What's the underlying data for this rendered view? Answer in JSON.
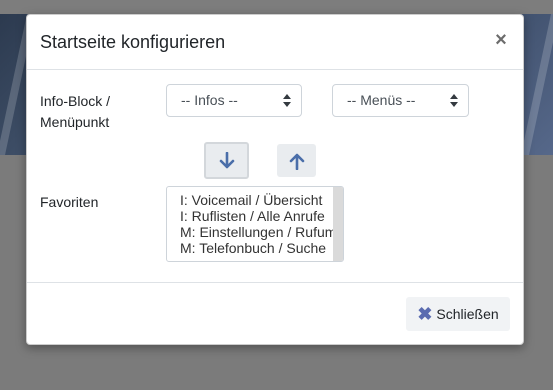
{
  "modal": {
    "title": "Startseite konfigurieren",
    "close_symbol": "×"
  },
  "form": {
    "info_block_label": "Info-Block / Menüpunkt",
    "infos_select": {
      "selected": "-- Infos --"
    },
    "menus_select": {
      "selected": "-- Menüs --"
    },
    "favorites_label": "Favoriten",
    "favorites": [
      "I: Voicemail / Übersicht",
      "I: Ruflisten / Alle Anrufe",
      "M: Einstellungen / Rufumleitung",
      "M: Telefonbuch / Suche"
    ]
  },
  "footer": {
    "close_label": "Schließen",
    "close_icon": "x-icon"
  },
  "icons": {
    "move_down": "arrow-down-icon",
    "move_up": "arrow-up-icon"
  },
  "colors": {
    "accent": "#5a6bb0",
    "arrow": "#4a6ea9"
  }
}
